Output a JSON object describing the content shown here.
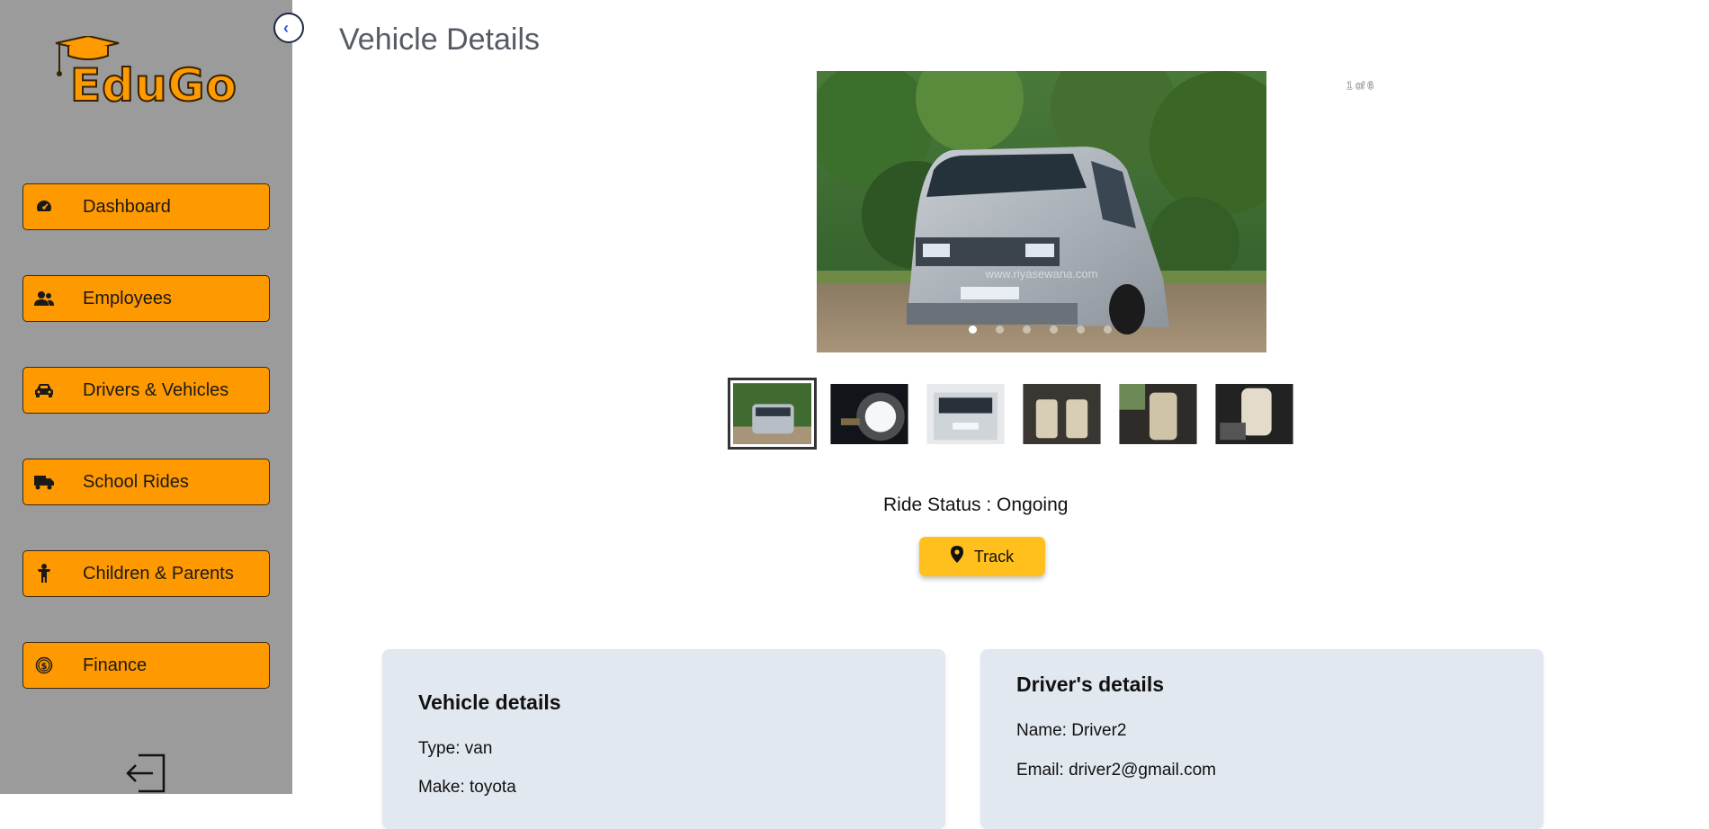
{
  "sidebar": {
    "logo_text": "EduGo",
    "nav": [
      {
        "label": "Dashboard",
        "icon": "dashboard-gauge-icon"
      },
      {
        "label": "Employees",
        "icon": "users-icon"
      },
      {
        "label": "Drivers & Vehicles",
        "icon": "car-icon"
      },
      {
        "label": "School Rides",
        "icon": "truck-icon"
      },
      {
        "label": "Children & Parents",
        "icon": "child-icon"
      },
      {
        "label": "Finance",
        "icon": "dollar-circle-icon"
      }
    ],
    "accent": "#ff9900",
    "background": "#9b9b9b"
  },
  "main": {
    "title": "Vehicle Details",
    "gallery": {
      "counter": "1 of 6",
      "slide_count": 6,
      "active_index": 0,
      "watermark": "www.riyasewana.com"
    },
    "ride_status": "Ride Status : Ongoing",
    "track_label": "Track",
    "vehicle_card": {
      "title": "Vehicle details",
      "type": "Type: van",
      "make": "Make: toyota"
    },
    "driver_card": {
      "title": "Driver's details",
      "name": "Name: Driver2",
      "email": "Email: driver2@gmail.com"
    }
  }
}
